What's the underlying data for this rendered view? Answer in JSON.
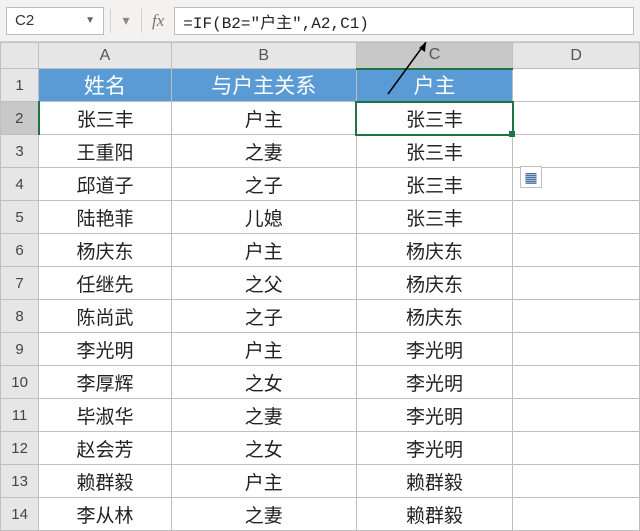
{
  "toolbar": {
    "cell_ref": "C2",
    "fx_label": "fx",
    "formula": "=IF(B2=\"户主\",A2,C1)"
  },
  "columns": [
    "A",
    "B",
    "C",
    "D"
  ],
  "row_headers": [
    "1",
    "2",
    "3",
    "4",
    "5",
    "6",
    "7",
    "8",
    "9",
    "10",
    "11",
    "12",
    "13",
    "14"
  ],
  "title_row": {
    "A": "姓名",
    "B": "与户主关系",
    "C": "户主"
  },
  "data_rows": [
    {
      "A": "张三丰",
      "B": "户主",
      "C": "张三丰"
    },
    {
      "A": "王重阳",
      "B": "之妻",
      "C": "张三丰"
    },
    {
      "A": "邱道子",
      "B": "之子",
      "C": "张三丰"
    },
    {
      "A": "陆艳菲",
      "B": "儿媳",
      "C": "张三丰"
    },
    {
      "A": "杨庆东",
      "B": "户主",
      "C": "杨庆东"
    },
    {
      "A": "任继先",
      "B": "之父",
      "C": "杨庆东"
    },
    {
      "A": "陈尚武",
      "B": "之子",
      "C": "杨庆东"
    },
    {
      "A": "李光明",
      "B": "户主",
      "C": "李光明"
    },
    {
      "A": "李厚辉",
      "B": "之女",
      "C": "李光明"
    },
    {
      "A": "毕淑华",
      "B": "之妻",
      "C": "李光明"
    },
    {
      "A": "赵会芳",
      "B": "之女",
      "C": "李光明"
    },
    {
      "A": "赖群毅",
      "B": "户主",
      "C": "赖群毅"
    },
    {
      "A": "李从林",
      "B": "之妻",
      "C": "赖群毅"
    }
  ],
  "chart_data": {
    "type": "table",
    "columns": [
      "姓名",
      "与户主关系",
      "户主"
    ],
    "rows": [
      [
        "张三丰",
        "户主",
        "张三丰"
      ],
      [
        "王重阳",
        "之妻",
        "张三丰"
      ],
      [
        "邱道子",
        "之子",
        "张三丰"
      ],
      [
        "陆艳菲",
        "儿媳",
        "张三丰"
      ],
      [
        "杨庆东",
        "户主",
        "杨庆东"
      ],
      [
        "任继先",
        "之父",
        "杨庆东"
      ],
      [
        "陈尚武",
        "之子",
        "杨庆东"
      ],
      [
        "李光明",
        "户主",
        "李光明"
      ],
      [
        "李厚辉",
        "之女",
        "李光明"
      ],
      [
        "毕淑华",
        "之妻",
        "李光明"
      ],
      [
        "赵会芳",
        "之女",
        "李光明"
      ],
      [
        "赖群毅",
        "户主",
        "赖群毅"
      ],
      [
        "李从林",
        "之妻",
        "赖群毅"
      ]
    ]
  }
}
